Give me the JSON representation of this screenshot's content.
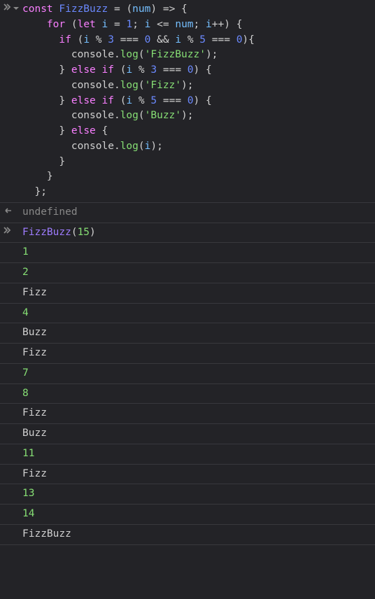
{
  "input1": {
    "tokens": [
      [
        [
          "kw",
          "const"
        ],
        [
          "sp",
          " "
        ],
        [
          "const-decl",
          "FizzBuzz"
        ],
        [
          "sp",
          " "
        ],
        [
          "op",
          "="
        ],
        [
          "sp",
          " "
        ],
        [
          "pun",
          "("
        ],
        [
          "var",
          "num"
        ],
        [
          "pun",
          ")"
        ],
        [
          "sp",
          " "
        ],
        [
          "op",
          "=>"
        ],
        [
          "sp",
          " "
        ],
        [
          "pun",
          "{"
        ]
      ],
      [
        [
          "sp",
          "    "
        ],
        [
          "kw",
          "for"
        ],
        [
          "sp",
          " "
        ],
        [
          "pun",
          "("
        ],
        [
          "kw",
          "let"
        ],
        [
          "sp",
          " "
        ],
        [
          "var",
          "i"
        ],
        [
          "sp",
          " "
        ],
        [
          "op",
          "="
        ],
        [
          "sp",
          " "
        ],
        [
          "num",
          "1"
        ],
        [
          "pun",
          ";"
        ],
        [
          "sp",
          " "
        ],
        [
          "var",
          "i"
        ],
        [
          "sp",
          " "
        ],
        [
          "op",
          "<="
        ],
        [
          "sp",
          " "
        ],
        [
          "var",
          "num"
        ],
        [
          "pun",
          ";"
        ],
        [
          "sp",
          " "
        ],
        [
          "var",
          "i"
        ],
        [
          "op",
          "++"
        ],
        [
          "pun",
          ")"
        ],
        [
          "sp",
          " "
        ],
        [
          "pun",
          "{"
        ]
      ],
      [
        [
          "sp",
          "      "
        ],
        [
          "kw",
          "if"
        ],
        [
          "sp",
          " "
        ],
        [
          "pun",
          "("
        ],
        [
          "var",
          "i"
        ],
        [
          "sp",
          " "
        ],
        [
          "op",
          "%"
        ],
        [
          "sp",
          " "
        ],
        [
          "num",
          "3"
        ],
        [
          "sp",
          " "
        ],
        [
          "op",
          "==="
        ],
        [
          "sp",
          " "
        ],
        [
          "num",
          "0"
        ],
        [
          "sp",
          " "
        ],
        [
          "op",
          "&&"
        ],
        [
          "sp",
          " "
        ],
        [
          "var",
          "i"
        ],
        [
          "sp",
          " "
        ],
        [
          "op",
          "%"
        ],
        [
          "sp",
          " "
        ],
        [
          "num",
          "5"
        ],
        [
          "sp",
          " "
        ],
        [
          "op",
          "==="
        ],
        [
          "sp",
          " "
        ],
        [
          "num",
          "0"
        ],
        [
          "pun",
          ")"
        ],
        [
          "pun",
          "{"
        ]
      ],
      [
        [
          "sp",
          "        "
        ],
        [
          "obj",
          "console"
        ],
        [
          "pun",
          "."
        ],
        [
          "fn",
          "log"
        ],
        [
          "pun",
          "("
        ],
        [
          "str",
          "'FizzBuzz'"
        ],
        [
          "pun",
          ")"
        ],
        [
          "pun",
          ";"
        ]
      ],
      [
        [
          "sp",
          "      "
        ],
        [
          "pun",
          "}"
        ],
        [
          "sp",
          " "
        ],
        [
          "kw",
          "else"
        ],
        [
          "sp",
          " "
        ],
        [
          "kw",
          "if"
        ],
        [
          "sp",
          " "
        ],
        [
          "pun",
          "("
        ],
        [
          "var",
          "i"
        ],
        [
          "sp",
          " "
        ],
        [
          "op",
          "%"
        ],
        [
          "sp",
          " "
        ],
        [
          "num",
          "3"
        ],
        [
          "sp",
          " "
        ],
        [
          "op",
          "==="
        ],
        [
          "sp",
          " "
        ],
        [
          "num",
          "0"
        ],
        [
          "pun",
          ")"
        ],
        [
          "sp",
          " "
        ],
        [
          "pun",
          "{"
        ]
      ],
      [
        [
          "sp",
          "        "
        ],
        [
          "obj",
          "console"
        ],
        [
          "pun",
          "."
        ],
        [
          "fn",
          "log"
        ],
        [
          "pun",
          "("
        ],
        [
          "str",
          "'Fizz'"
        ],
        [
          "pun",
          ")"
        ],
        [
          "pun",
          ";"
        ]
      ],
      [
        [
          "sp",
          "      "
        ],
        [
          "pun",
          "}"
        ],
        [
          "sp",
          " "
        ],
        [
          "kw",
          "else"
        ],
        [
          "sp",
          " "
        ],
        [
          "kw",
          "if"
        ],
        [
          "sp",
          " "
        ],
        [
          "pun",
          "("
        ],
        [
          "var",
          "i"
        ],
        [
          "sp",
          " "
        ],
        [
          "op",
          "%"
        ],
        [
          "sp",
          " "
        ],
        [
          "num",
          "5"
        ],
        [
          "sp",
          " "
        ],
        [
          "op",
          "==="
        ],
        [
          "sp",
          " "
        ],
        [
          "num",
          "0"
        ],
        [
          "pun",
          ")"
        ],
        [
          "sp",
          " "
        ],
        [
          "pun",
          "{"
        ]
      ],
      [
        [
          "sp",
          "        "
        ],
        [
          "obj",
          "console"
        ],
        [
          "pun",
          "."
        ],
        [
          "fn",
          "log"
        ],
        [
          "pun",
          "("
        ],
        [
          "str",
          "'Buzz'"
        ],
        [
          "pun",
          ")"
        ],
        [
          "pun",
          ";"
        ]
      ],
      [
        [
          "sp",
          "      "
        ],
        [
          "pun",
          "}"
        ],
        [
          "sp",
          " "
        ],
        [
          "kw",
          "else"
        ],
        [
          "sp",
          " "
        ],
        [
          "pun",
          "{"
        ]
      ],
      [
        [
          "sp",
          "        "
        ],
        [
          "obj",
          "console"
        ],
        [
          "pun",
          "."
        ],
        [
          "fn",
          "log"
        ],
        [
          "pun",
          "("
        ],
        [
          "var",
          "i"
        ],
        [
          "pun",
          ")"
        ],
        [
          "pun",
          ";"
        ]
      ],
      [
        [
          "sp",
          "      "
        ],
        [
          "pun",
          "}"
        ]
      ],
      [
        [
          "sp",
          "    "
        ],
        [
          "pun",
          "}"
        ]
      ],
      [
        [
          "sp",
          "  "
        ],
        [
          "pun",
          "}"
        ],
        [
          "pun",
          ";"
        ]
      ]
    ]
  },
  "result1": {
    "value": "undefined"
  },
  "input2": {
    "tokens": [
      [
        [
          "call-fn",
          "FizzBuzz"
        ],
        [
          "pun",
          "("
        ],
        [
          "call-num",
          "15"
        ],
        [
          "pun",
          ")"
        ]
      ]
    ]
  },
  "outputs": [
    {
      "type": "num",
      "value": "1"
    },
    {
      "type": "num",
      "value": "2"
    },
    {
      "type": "str",
      "value": "Fizz"
    },
    {
      "type": "num",
      "value": "4"
    },
    {
      "type": "str",
      "value": "Buzz"
    },
    {
      "type": "str",
      "value": "Fizz"
    },
    {
      "type": "num",
      "value": "7"
    },
    {
      "type": "num",
      "value": "8"
    },
    {
      "type": "str",
      "value": "Fizz"
    },
    {
      "type": "str",
      "value": "Buzz"
    },
    {
      "type": "num",
      "value": "11"
    },
    {
      "type": "str",
      "value": "Fizz"
    },
    {
      "type": "num",
      "value": "13"
    },
    {
      "type": "num",
      "value": "14"
    },
    {
      "type": "str",
      "value": "FizzBuzz"
    }
  ]
}
